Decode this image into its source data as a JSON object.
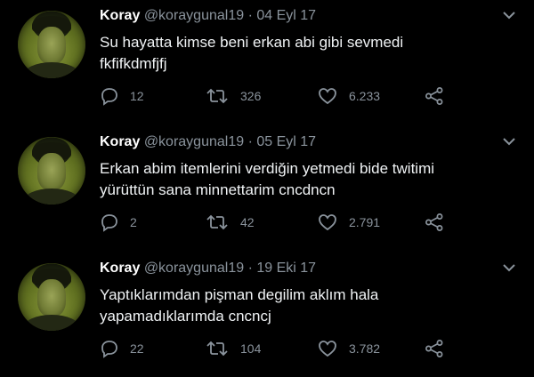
{
  "colors": {
    "background": "#000000",
    "name": "#ffffff",
    "text": "#f0f3f5",
    "muted": "#8a939c"
  },
  "tweets": [
    {
      "name": "Koray",
      "handle": "@koraygunal19",
      "separator": "·",
      "date": "04 Eyl 17",
      "lines": [
        "Su hayatta kimse beni erkan abi gibi sevmedi",
        "fkfifkdmfjfj"
      ],
      "replies": "12",
      "retweets": "326",
      "likes": "6.233",
      "icons": [
        "reply-icon",
        "retweet-icon",
        "like-icon",
        "share-icon",
        "chevron-down-icon"
      ]
    },
    {
      "name": "Koray",
      "handle": "@koraygunal19",
      "separator": "·",
      "date": "05 Eyl 17",
      "lines": [
        "Erkan abim itemlerini verdiğin yetmedi bide twitimi",
        "yürüttün sana minnettarim cncdncn"
      ],
      "replies": "2",
      "retweets": "42",
      "likes": "2.791",
      "icons": [
        "reply-icon",
        "retweet-icon",
        "like-icon",
        "share-icon",
        "chevron-down-icon"
      ]
    },
    {
      "name": "Koray",
      "handle": "@koraygunal19",
      "separator": "·",
      "date": "19 Eki 17",
      "lines": [
        "Yaptıklarımdan pişman degilim aklım hala",
        "yapamadıklarımda cncncj"
      ],
      "replies": "22",
      "retweets": "104",
      "likes": "3.782",
      "icons": [
        "reply-icon",
        "retweet-icon",
        "like-icon",
        "share-icon",
        "chevron-down-icon"
      ]
    }
  ]
}
